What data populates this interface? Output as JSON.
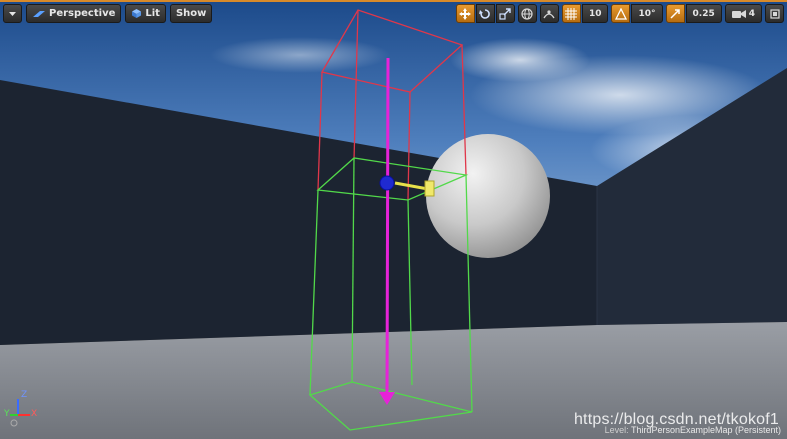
{
  "toolbar": {
    "dropdown_icon": "chevron-down-icon",
    "perspective_label": "Perspective",
    "lit_label": "Lit",
    "show_label": "Show",
    "grid_snap_value": "10",
    "rotation_snap_value": "10°",
    "scale_snap_value": "0.25",
    "camera_speed_value": "4"
  },
  "viewport": {
    "level_prefix": "Level:",
    "level_name": "ThirdPersonExampleMap (Persistent)",
    "watermark": "https://blog.csdn.net/tkokof1"
  },
  "axis_gizmo": {
    "x_label": "X",
    "y_label": "Y",
    "z_label": "Z"
  },
  "colors": {
    "accent": "#d88a2a",
    "sky_top": "#1f4f8f",
    "wall": "#1b2432",
    "floor": "#8f939a",
    "outer_box": "#e0374a",
    "inner_box": "#52d94a",
    "arrow": "#e623d8"
  }
}
